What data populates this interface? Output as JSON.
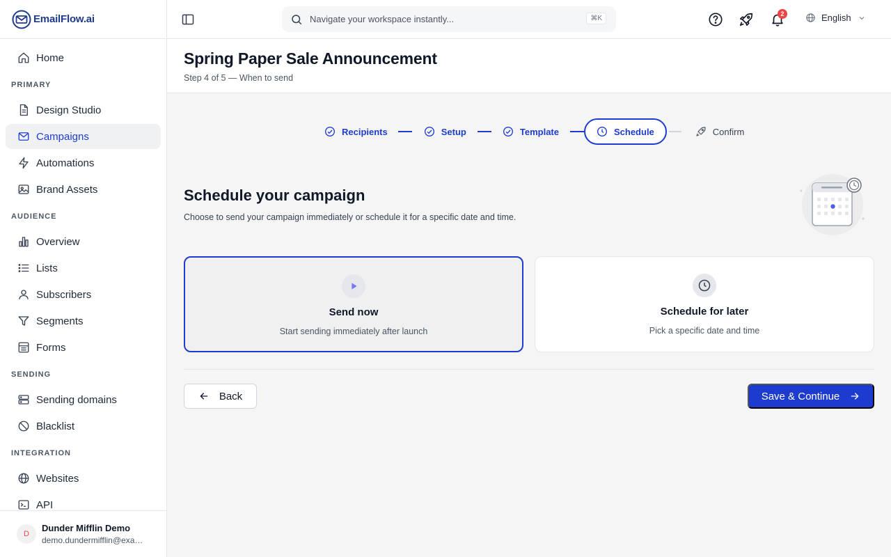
{
  "app": {
    "name": "EmailFlow.ai",
    "colors": {
      "accent": "#1d3ccf",
      "badge": "#ef4444",
      "brand": "#1e3a8a"
    }
  },
  "sidebar": {
    "home": {
      "label": "Home",
      "icon": "home-icon"
    },
    "sections": [
      {
        "title": "PRIMARY",
        "items": [
          {
            "label": "Design Studio",
            "icon": "document-icon"
          },
          {
            "label": "Campaigns",
            "icon": "mail-icon",
            "active": true
          },
          {
            "label": "Automations",
            "icon": "lightning-icon"
          },
          {
            "label": "Brand Assets",
            "icon": "image-icon"
          }
        ]
      },
      {
        "title": "AUDIENCE",
        "items": [
          {
            "label": "Overview",
            "icon": "bar-chart-icon"
          },
          {
            "label": "Lists",
            "icon": "list-icon"
          },
          {
            "label": "Subscribers",
            "icon": "user-icon"
          },
          {
            "label": "Segments",
            "icon": "filter-icon"
          },
          {
            "label": "Forms",
            "icon": "form-icon"
          }
        ]
      },
      {
        "title": "SENDING",
        "items": [
          {
            "label": "Sending domains",
            "icon": "server-icon"
          },
          {
            "label": "Blacklist",
            "icon": "ban-icon"
          }
        ]
      },
      {
        "title": "INTEGRATION",
        "items": [
          {
            "label": "Websites",
            "icon": "globe-icon"
          },
          {
            "label": "API",
            "icon": "terminal-icon"
          }
        ]
      }
    ],
    "user": {
      "initial": "D",
      "name": "Dunder Mifflin Demo",
      "email": "demo.dundermifflin@example.com"
    }
  },
  "topbar": {
    "search_placeholder": "Navigate your workspace instantly...",
    "shortcut": "⌘K",
    "notifications_count": "2",
    "language": "English"
  },
  "header": {
    "title": "Spring Paper Sale Announcement",
    "subtitle": "Step 4 of 5 — When to send"
  },
  "stepper": {
    "steps": [
      {
        "label": "Recipients",
        "state": "done"
      },
      {
        "label": "Setup",
        "state": "done"
      },
      {
        "label": "Template",
        "state": "done"
      },
      {
        "label": "Schedule",
        "state": "current"
      },
      {
        "label": "Confirm",
        "state": "pending"
      }
    ]
  },
  "schedule": {
    "title": "Schedule your campaign",
    "description": "Choose to send your campaign immediately or schedule it for a specific date and time.",
    "options": [
      {
        "title": "Send now",
        "description": "Start sending immediately after launch",
        "selected": true,
        "icon": "play-icon"
      },
      {
        "title": "Schedule for later",
        "description": "Pick a specific date and time",
        "selected": false,
        "icon": "clock-icon"
      }
    ]
  },
  "actions": {
    "back_label": "Back",
    "next_label": "Save & Continue"
  }
}
